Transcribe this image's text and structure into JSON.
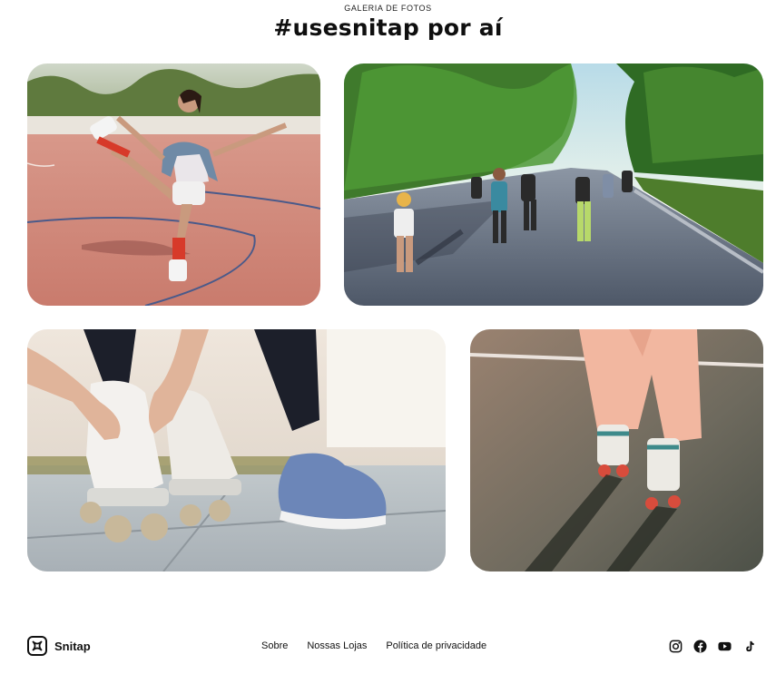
{
  "header": {
    "eyebrow": "GALERIA DE FOTOS",
    "title": "#usesnitap por aí"
  },
  "gallery": {
    "photos": [
      {
        "subject": "woman-skating-on-court-photo"
      },
      {
        "subject": "group-skating-park-path-photo"
      },
      {
        "subject": "lacing-roller-skates-photo"
      },
      {
        "subject": "skater-pink-pants-photo"
      }
    ]
  },
  "footer": {
    "brand": "Snitap",
    "links": [
      "Sobre",
      "Nossas Lojas",
      "Política de privacidade"
    ],
    "social": [
      "instagram-icon",
      "facebook-icon",
      "youtube-icon",
      "tiktok-icon"
    ]
  },
  "colors": {
    "text": "#111111",
    "background": "#ffffff"
  }
}
